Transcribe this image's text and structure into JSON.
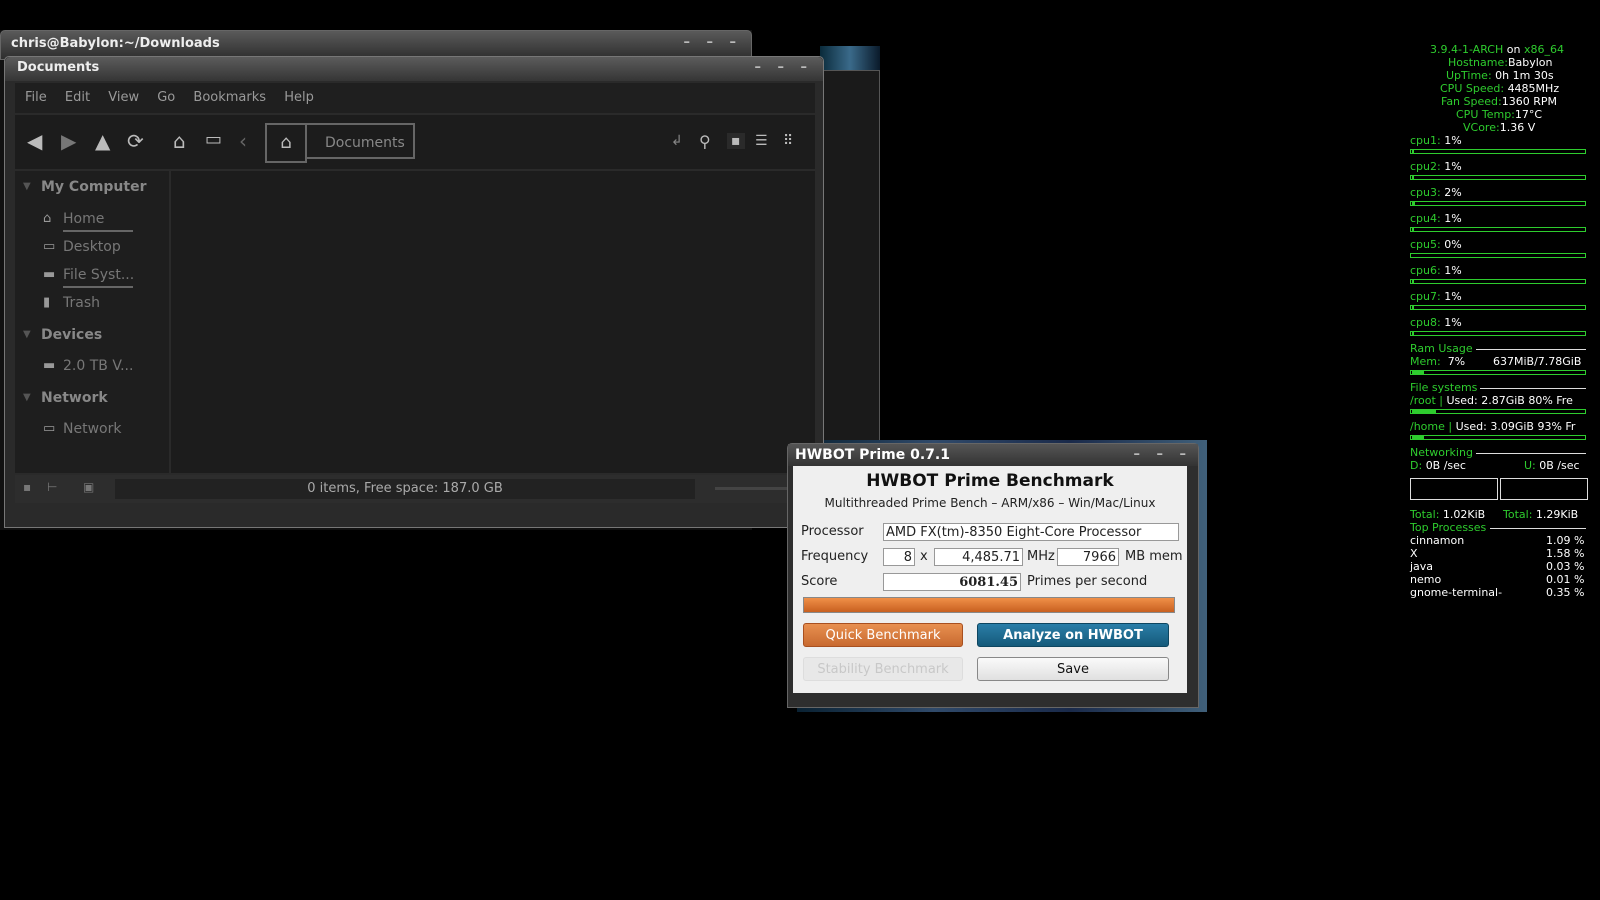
{
  "terminal": {
    "title": "chris@Babylon:~/Downloads",
    "controls": "– – –"
  },
  "nemo": {
    "title": "Documents",
    "controls": "– – –",
    "menu": [
      "File",
      "Edit",
      "View",
      "Go",
      "Bookmarks",
      "Help"
    ],
    "path_label": "Documents",
    "sidebar": {
      "my_computer": "My Computer",
      "home": "Home",
      "desktop": "Desktop",
      "filesystem": "File Syst...",
      "trash": "Trash",
      "devices": "Devices",
      "drive": "2.0 TB V...",
      "network_header": "Network",
      "network": "Network"
    },
    "status": "0 items, Free space: 187.0 GB"
  },
  "hwbot": {
    "title": "HWBOT Prime 0.7.1",
    "controls": "– – –",
    "heading": "HWBOT Prime Benchmark",
    "subheading": "Multithreaded Prime Bench – ARM/x86 – Win/Mac/Linux",
    "processor_label": "Processor",
    "processor_value": "AMD FX(tm)-8350 Eight-Core Processor",
    "frequency_label": "Frequency",
    "cores": "8",
    "times": "x",
    "mhz_value": "4,485.71",
    "mhz_unit": "MHz",
    "mem_value": "7966",
    "mem_unit": "MB mem",
    "score_label": "Score",
    "score_value": "6081.45",
    "score_unit": "Primes per second",
    "progress": 1.0,
    "quick_btn": "Quick Benchmark",
    "analyze_btn": "Analyze on HWBOT",
    "stability_btn": "Stability Benchmark",
    "save_btn": "Save",
    "colors": {
      "accent_orange": "#d8783a",
      "accent_blue": "#1e6a8c"
    }
  },
  "conky": {
    "kernel": "3.9.4-1-ARCH",
    "on": "on",
    "arch": "x86_64",
    "hostname_label": "Hostname:",
    "hostname": "Babylon",
    "uptime_label": "UpTime:",
    "uptime": "0h 1m 30s",
    "cpuspeed_label": "CPU Speed:",
    "cpuspeed": "4485MHz",
    "fan_label": "Fan Speed:",
    "fan": "1360 RPM",
    "cputemp_label": "CPU Temp:",
    "cputemp": "17°C",
    "vcore_label": "VCore:",
    "vcore": "1.36 V",
    "cpus": [
      {
        "label": "cpu1:",
        "value": "1%",
        "frac": 0.01
      },
      {
        "label": "cpu2:",
        "value": "1%",
        "frac": 0.01
      },
      {
        "label": "cpu3:",
        "value": "2%",
        "frac": 0.02
      },
      {
        "label": "cpu4:",
        "value": "1%",
        "frac": 0.01
      },
      {
        "label": "cpu5:",
        "value": "0%",
        "frac": 0.0
      },
      {
        "label": "cpu6:",
        "value": "1%",
        "frac": 0.01
      },
      {
        "label": "cpu7:",
        "value": "1%",
        "frac": 0.01
      },
      {
        "label": "cpu8:",
        "value": "1%",
        "frac": 0.01
      }
    ],
    "ram_header": "Ram Usage",
    "mem_label": "Mem:",
    "mem_pct": "7%",
    "mem_used": "637MiB/7.78GiB",
    "mem_frac": 0.07,
    "fs_header": "File systems",
    "root_label": "/root |",
    "root_text": "Used: 2.87GiB 80% Fre",
    "root_frac": 0.14,
    "home_label": "/home |",
    "home_text": "Used: 3.09GiB 93% Fr",
    "home_frac": 0.07,
    "net_header": "Networking",
    "down_label": "D:",
    "down_value": "0B  /sec",
    "up_label": "U:",
    "up_value": "0B  /sec",
    "total_down_label": "Total:",
    "total_down": "1.02KiB",
    "total_up_label": "Total:",
    "total_up": "1.29KiB",
    "top_header": "Top Processes",
    "processes": [
      {
        "name": "cinnamon",
        "cpu": "1.09 %"
      },
      {
        "name": "X",
        "cpu": "1.58 %"
      },
      {
        "name": "java",
        "cpu": "0.03 %"
      },
      {
        "name": "nemo",
        "cpu": "0.01 %"
      },
      {
        "name": "gnome-terminal-",
        "cpu": "0.35 %"
      }
    ]
  }
}
